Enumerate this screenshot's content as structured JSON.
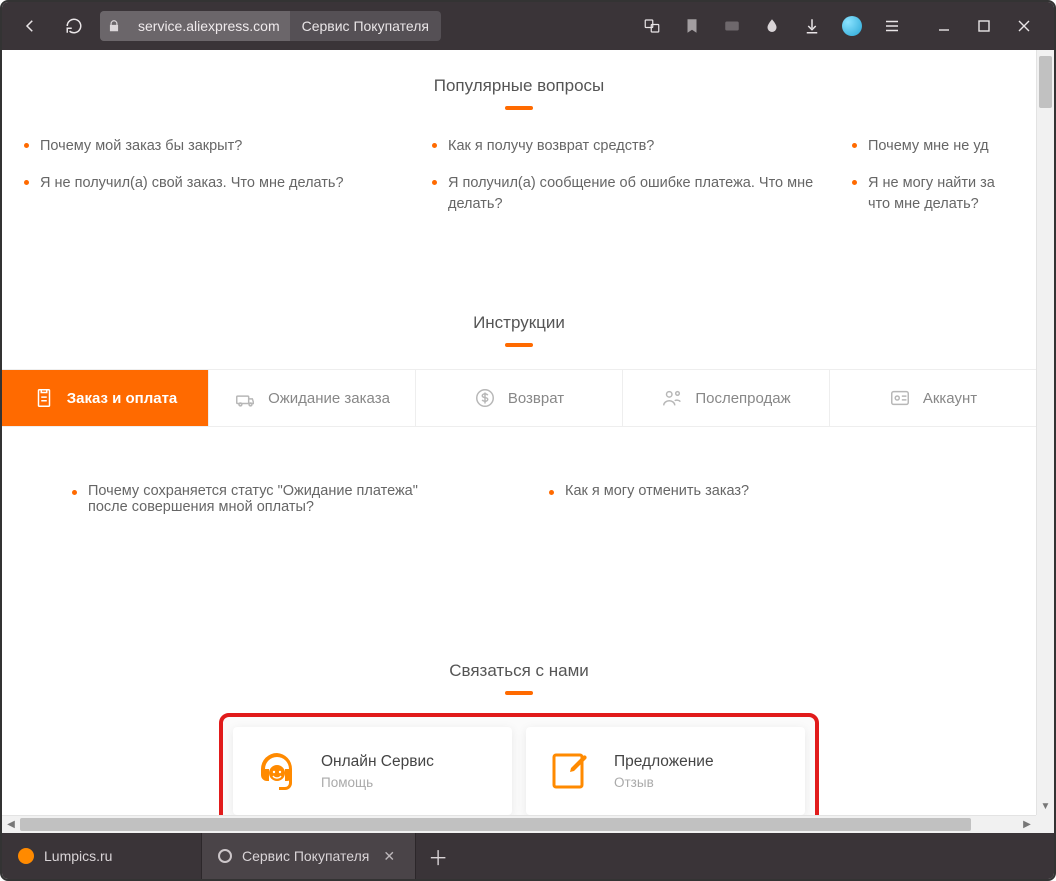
{
  "chrome": {
    "url_host": "service.aliexpress.com",
    "page_title": "Сервис Покупателя"
  },
  "sections": {
    "popular": {
      "title": "Популярные вопросы",
      "colA": [
        "Почему мой заказ бы закрыт?",
        "Я не получил(а) свой заказ. Что мне делать?"
      ],
      "colB": [
        "Как я получу возврат средств?",
        "Я получил(а) сообщение об ошибке платежа. Что мне делать?"
      ],
      "colC": [
        "Почему мне не уд",
        "Я не могу найти за\nчто мне делать?"
      ]
    },
    "instructions": {
      "title": "Инструкции",
      "tabs": [
        {
          "label": "Заказ и оплата",
          "active": true
        },
        {
          "label": "Ожидание заказа",
          "active": false
        },
        {
          "label": "Возврат",
          "active": false
        },
        {
          "label": "Послепродаж",
          "active": false
        },
        {
          "label": "Аккаунт",
          "active": false
        }
      ],
      "items": [
        "Почему сохраняется статус \"Ожидание платежа\" после совершения мной оплаты?",
        "Как я могу отменить заказ?"
      ]
    },
    "contact": {
      "title": "Связаться с нами",
      "cards": [
        {
          "title": "Онлайн Сервис",
          "subtitle": "Помощь"
        },
        {
          "title": "Предложение",
          "subtitle": "Отзыв"
        }
      ]
    }
  },
  "tabs_bottom": [
    {
      "label": "Lumpics.ru",
      "active": false
    },
    {
      "label": "Сервис Покупателя",
      "active": true
    }
  ]
}
